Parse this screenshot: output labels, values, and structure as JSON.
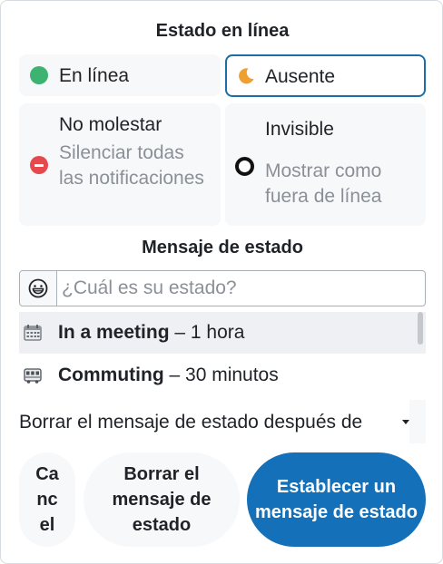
{
  "dialog": {
    "title": "Estado en línea",
    "statuses": {
      "online": {
        "label": "En línea",
        "icon": "online-dot-icon"
      },
      "away": {
        "label": "Ausente",
        "icon": "moon-icon",
        "selected": true
      },
      "dnd": {
        "label": "No molestar",
        "description": "Silenciar todas las notificaciones",
        "icon": "do-not-disturb-icon"
      },
      "invisible": {
        "label": "Invisible",
        "description": "Mostrar como fuera de línea",
        "icon": "invisible-ring-icon"
      }
    },
    "message_section_title": "Mensaje de estado",
    "status_input": {
      "placeholder": "¿Cuál es su estado?",
      "value": "",
      "emoji_icon": "grinning-face-icon"
    },
    "suggestions": [
      {
        "title": "In a meeting",
        "separator": " – ",
        "duration": "1 hora",
        "icon": "calendar-icon"
      },
      {
        "title": "Commuting",
        "separator": " – ",
        "duration": "30 minutos",
        "icon": "bus-icon"
      }
    ],
    "clear_after": {
      "label": "Borrar el mensaje de estado después de"
    },
    "buttons": {
      "cancel": "Cancel",
      "clear": "Borrar el mensaje de estado",
      "set": "Establecer un mensaje de estado"
    }
  },
  "colors": {
    "accent": "#1470b8",
    "online": "#3cb371",
    "away": "#f0a030",
    "dnd": "#e5484d"
  }
}
